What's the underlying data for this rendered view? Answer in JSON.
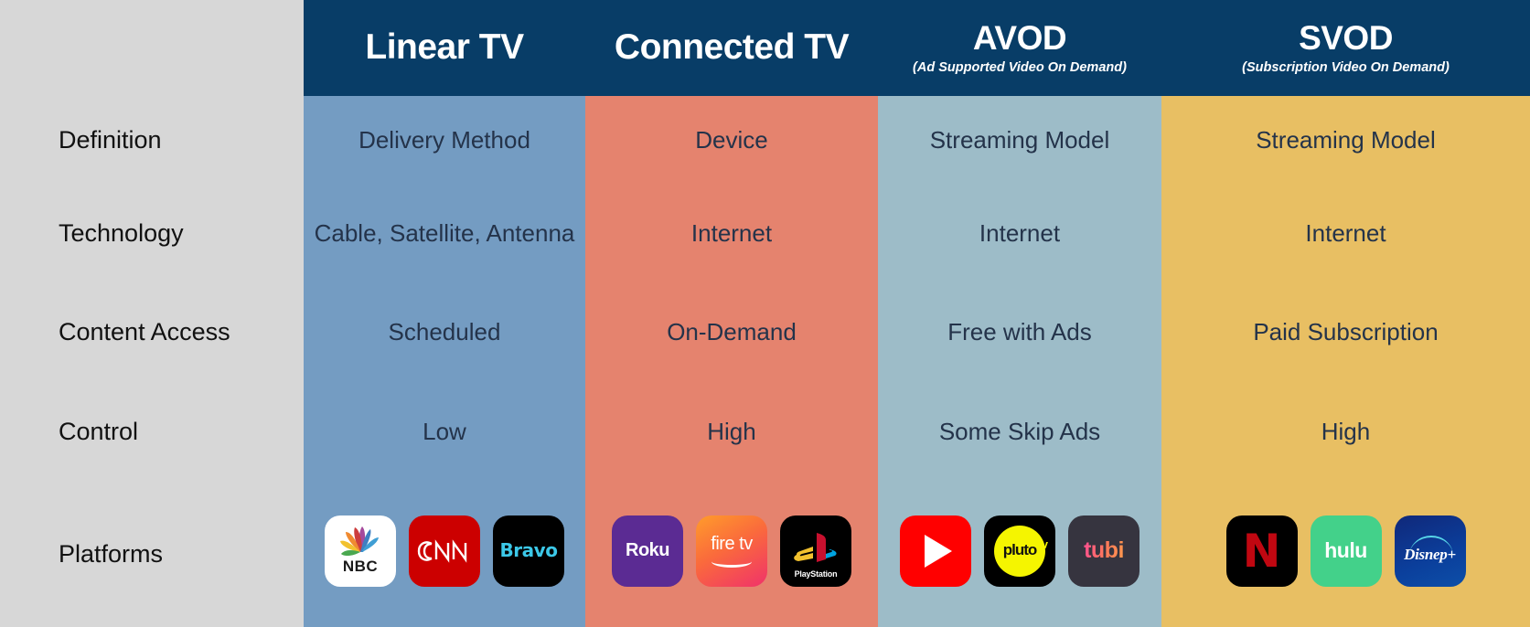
{
  "header": {
    "columns": [
      {
        "title": "Linear TV",
        "subtitle": ""
      },
      {
        "title": "Connected TV",
        "subtitle": ""
      },
      {
        "title": "AVOD",
        "subtitle": "(Ad Supported Video On Demand)"
      },
      {
        "title": "SVOD",
        "subtitle": "(Subscription Video On Demand)"
      }
    ],
    "bg_color": "#083d67",
    "text_color": "#ffffff"
  },
  "rows": {
    "labels": [
      "Definition",
      "Technology",
      "Content Access",
      "Control",
      "Platforms"
    ]
  },
  "columns": {
    "linear_tv": {
      "name": "Linear TV",
      "bg_color": "#749cc2",
      "definition": "Delivery Method",
      "technology": "Cable, Satellite, Antenna",
      "content_access": "Scheduled",
      "control": "Low",
      "platforms": [
        "NBC",
        "CNN",
        "Bravo"
      ]
    },
    "connected_tv": {
      "name": "Connected TV",
      "bg_color": "#e5836e",
      "definition": "Device",
      "technology": "Internet",
      "content_access": "On-Demand",
      "control": "High",
      "platforms": [
        "Roku",
        "fire tv",
        "PlayStation"
      ]
    },
    "avod": {
      "name": "AVOD",
      "bg_color": "#9dbcc8",
      "definition": "Streaming Model",
      "technology": "Internet",
      "content_access": "Free with Ads",
      "control": "Some Skip Ads",
      "platforms": [
        "YouTube",
        "pluto tv",
        "tubi"
      ]
    },
    "svod": {
      "name": "SVOD",
      "bg_color": "#e8bf63",
      "definition": "Streaming Model",
      "technology": "Internet",
      "content_access": "Paid Subscription",
      "control": "High",
      "platforms": [
        "Netflix",
        "hulu",
        "Disney+"
      ]
    }
  },
  "logos": {
    "nbc_label": "NBC",
    "cnn_label": "CNN",
    "bravo_label": "Bravo",
    "roku_label": "Roku",
    "firetv_label": "fire tv",
    "playstation_label": "PlayStation",
    "pluto_label": "pluto",
    "pluto_tv_suffix": "tv",
    "tubi_label": "tubi",
    "netflix_label": "N",
    "hulu_label": "hulu",
    "disney_label": "Disnep+"
  },
  "sidebar": {
    "bg_color": "#d7d7d7",
    "text_color": "#111111"
  }
}
